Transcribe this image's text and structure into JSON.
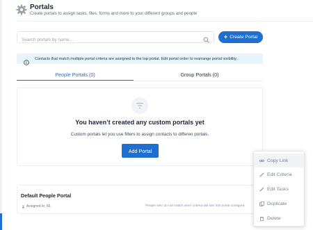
{
  "header": {
    "title": "Portals",
    "subtitle": "Create portals to assign tasks, files, forms and more to your different groups and people",
    "icon": "gear-icon"
  },
  "search": {
    "placeholder": "Search portals by name..."
  },
  "create_button": {
    "label": "Create Portal"
  },
  "info_banner": {
    "text": "Contacts that match multiple portal criteria are assigned to the top portal. Edit portal order to rearrange portal visibility."
  },
  "tabs": [
    {
      "label": "People Portals (0)",
      "active": true
    },
    {
      "label": "Group Portals (0)",
      "active": false
    }
  ],
  "empty_state": {
    "title": "You haven’t created any custom portals yet",
    "description": "Custom portals let you use filters to assign contacts to differen portals.",
    "button_label": "Add Portal"
  },
  "default_portal": {
    "title": "Default People Portal",
    "assigned": "Assigned to: 65",
    "note": "People who do not match other criteria will see this portal configura"
  },
  "context_menu": {
    "items": [
      {
        "label": "Copy Link",
        "icon": "link-icon"
      },
      {
        "label": "Edit Criteria",
        "icon": "pencil-icon"
      },
      {
        "label": "Edit Tasks",
        "icon": "pencil-icon"
      },
      {
        "label": "Duplicate",
        "icon": "duplicate-icon"
      },
      {
        "label": "Delete",
        "icon": "trash-icon"
      }
    ]
  },
  "colors": {
    "accent": "#1f6fd1",
    "banner_bg": "#e8f4fb"
  }
}
